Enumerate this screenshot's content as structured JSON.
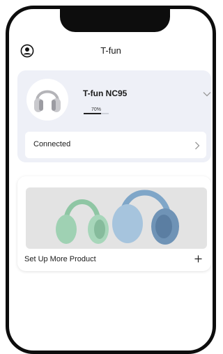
{
  "header": {
    "title": "T-fun",
    "profile_icon": "profile-icon"
  },
  "device": {
    "name": "T-fun NC95",
    "battery_percent": 70,
    "battery_label": "70%",
    "status_label": "Connected",
    "expand_icon": "chevron-down-icon",
    "status_icon": "chevron-right-icon"
  },
  "product_promo": {
    "label": "Set Up More Product",
    "add_icon": "plus-icon"
  },
  "colors": {
    "card_background": "#eef0f7",
    "headphone_green": "#9fcfb0",
    "headphone_blue": "#8fb2cf"
  }
}
